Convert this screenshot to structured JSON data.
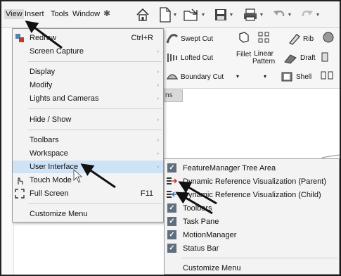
{
  "menubar": {
    "items": [
      "View",
      "Insert",
      "Tools",
      "Window"
    ]
  },
  "features": {
    "swept_cut": "Swept Cut",
    "lofted_cut": "Lofted Cut",
    "boundary_cut": "Boundary Cut",
    "fillet": "Fillet",
    "linear_pattern_1": "Linear",
    "linear_pattern_2": "Pattern",
    "rib": "Rib",
    "draft": "Draft",
    "shell": "Shell"
  },
  "tab_strip": "ns",
  "view_menu": {
    "items": [
      {
        "label": "Redraw",
        "shortcut": "Ctrl+R",
        "icon": "redraw-icon"
      },
      {
        "label": "Screen Capture",
        "submenu": true
      },
      {
        "label": "Display",
        "submenu": true
      },
      {
        "label": "Modify",
        "submenu": true
      },
      {
        "label": "Lights and Cameras",
        "submenu": true
      },
      {
        "label": "Hide / Show",
        "submenu": true
      },
      {
        "label": "Toolbars",
        "submenu": true
      },
      {
        "label": "Workspace",
        "submenu": true
      },
      {
        "label": "User Interface",
        "submenu": true,
        "highlighted": true
      },
      {
        "label": "Touch Mode",
        "icon": "touch-icon"
      },
      {
        "label": "Full Screen",
        "shortcut": "F11",
        "icon": "fullscreen-icon"
      },
      {
        "label": "Customize Menu"
      }
    ]
  },
  "ui_menu": {
    "items": [
      {
        "label": "FeatureManager Tree Area",
        "checked": true
      },
      {
        "label": "Dynamic Reference Visualization (Parent)",
        "icon": "parent-ref-icon"
      },
      {
        "label": "Dynamic Reference Visualization (Child)",
        "icon": "child-ref-icon"
      },
      {
        "label": "Toolbars",
        "checked": true
      },
      {
        "label": "Task Pane",
        "checked": true
      },
      {
        "label": "MotionManager",
        "checked": true
      },
      {
        "label": "Status Bar",
        "checked": true
      },
      {
        "label": "Customize Menu"
      }
    ]
  },
  "colors": {
    "highlight": "#cfe3f7",
    "check": "#5f6f80",
    "arrow": "#111111"
  }
}
